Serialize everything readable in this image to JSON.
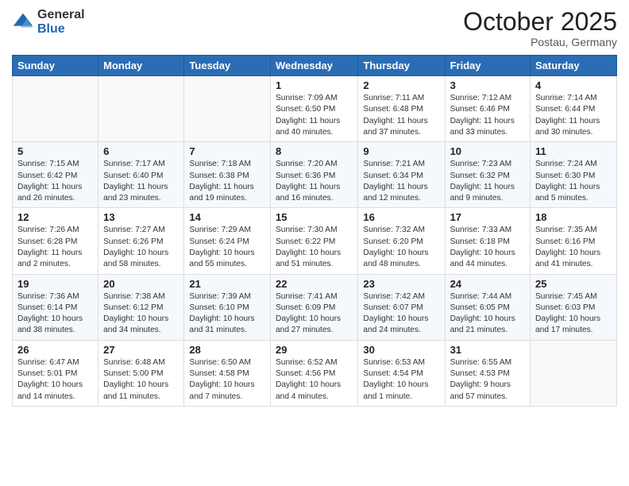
{
  "logo": {
    "general": "General",
    "blue": "Blue"
  },
  "header": {
    "month": "October 2025",
    "location": "Postau, Germany"
  },
  "days_of_week": [
    "Sunday",
    "Monday",
    "Tuesday",
    "Wednesday",
    "Thursday",
    "Friday",
    "Saturday"
  ],
  "weeks": [
    [
      {
        "day": "",
        "info": ""
      },
      {
        "day": "",
        "info": ""
      },
      {
        "day": "",
        "info": ""
      },
      {
        "day": "1",
        "info": "Sunrise: 7:09 AM\nSunset: 6:50 PM\nDaylight: 11 hours and 40 minutes."
      },
      {
        "day": "2",
        "info": "Sunrise: 7:11 AM\nSunset: 6:48 PM\nDaylight: 11 hours and 37 minutes."
      },
      {
        "day": "3",
        "info": "Sunrise: 7:12 AM\nSunset: 6:46 PM\nDaylight: 11 hours and 33 minutes."
      },
      {
        "day": "4",
        "info": "Sunrise: 7:14 AM\nSunset: 6:44 PM\nDaylight: 11 hours and 30 minutes."
      }
    ],
    [
      {
        "day": "5",
        "info": "Sunrise: 7:15 AM\nSunset: 6:42 PM\nDaylight: 11 hours and 26 minutes."
      },
      {
        "day": "6",
        "info": "Sunrise: 7:17 AM\nSunset: 6:40 PM\nDaylight: 11 hours and 23 minutes."
      },
      {
        "day": "7",
        "info": "Sunrise: 7:18 AM\nSunset: 6:38 PM\nDaylight: 11 hours and 19 minutes."
      },
      {
        "day": "8",
        "info": "Sunrise: 7:20 AM\nSunset: 6:36 PM\nDaylight: 11 hours and 16 minutes."
      },
      {
        "day": "9",
        "info": "Sunrise: 7:21 AM\nSunset: 6:34 PM\nDaylight: 11 hours and 12 minutes."
      },
      {
        "day": "10",
        "info": "Sunrise: 7:23 AM\nSunset: 6:32 PM\nDaylight: 11 hours and 9 minutes."
      },
      {
        "day": "11",
        "info": "Sunrise: 7:24 AM\nSunset: 6:30 PM\nDaylight: 11 hours and 5 minutes."
      }
    ],
    [
      {
        "day": "12",
        "info": "Sunrise: 7:26 AM\nSunset: 6:28 PM\nDaylight: 11 hours and 2 minutes."
      },
      {
        "day": "13",
        "info": "Sunrise: 7:27 AM\nSunset: 6:26 PM\nDaylight: 10 hours and 58 minutes."
      },
      {
        "day": "14",
        "info": "Sunrise: 7:29 AM\nSunset: 6:24 PM\nDaylight: 10 hours and 55 minutes."
      },
      {
        "day": "15",
        "info": "Sunrise: 7:30 AM\nSunset: 6:22 PM\nDaylight: 10 hours and 51 minutes."
      },
      {
        "day": "16",
        "info": "Sunrise: 7:32 AM\nSunset: 6:20 PM\nDaylight: 10 hours and 48 minutes."
      },
      {
        "day": "17",
        "info": "Sunrise: 7:33 AM\nSunset: 6:18 PM\nDaylight: 10 hours and 44 minutes."
      },
      {
        "day": "18",
        "info": "Sunrise: 7:35 AM\nSunset: 6:16 PM\nDaylight: 10 hours and 41 minutes."
      }
    ],
    [
      {
        "day": "19",
        "info": "Sunrise: 7:36 AM\nSunset: 6:14 PM\nDaylight: 10 hours and 38 minutes."
      },
      {
        "day": "20",
        "info": "Sunrise: 7:38 AM\nSunset: 6:12 PM\nDaylight: 10 hours and 34 minutes."
      },
      {
        "day": "21",
        "info": "Sunrise: 7:39 AM\nSunset: 6:10 PM\nDaylight: 10 hours and 31 minutes."
      },
      {
        "day": "22",
        "info": "Sunrise: 7:41 AM\nSunset: 6:09 PM\nDaylight: 10 hours and 27 minutes."
      },
      {
        "day": "23",
        "info": "Sunrise: 7:42 AM\nSunset: 6:07 PM\nDaylight: 10 hours and 24 minutes."
      },
      {
        "day": "24",
        "info": "Sunrise: 7:44 AM\nSunset: 6:05 PM\nDaylight: 10 hours and 21 minutes."
      },
      {
        "day": "25",
        "info": "Sunrise: 7:45 AM\nSunset: 6:03 PM\nDaylight: 10 hours and 17 minutes."
      }
    ],
    [
      {
        "day": "26",
        "info": "Sunrise: 6:47 AM\nSunset: 5:01 PM\nDaylight: 10 hours and 14 minutes."
      },
      {
        "day": "27",
        "info": "Sunrise: 6:48 AM\nSunset: 5:00 PM\nDaylight: 10 hours and 11 minutes."
      },
      {
        "day": "28",
        "info": "Sunrise: 6:50 AM\nSunset: 4:58 PM\nDaylight: 10 hours and 7 minutes."
      },
      {
        "day": "29",
        "info": "Sunrise: 6:52 AM\nSunset: 4:56 PM\nDaylight: 10 hours and 4 minutes."
      },
      {
        "day": "30",
        "info": "Sunrise: 6:53 AM\nSunset: 4:54 PM\nDaylight: 10 hours and 1 minute."
      },
      {
        "day": "31",
        "info": "Sunrise: 6:55 AM\nSunset: 4:53 PM\nDaylight: 9 hours and 57 minutes."
      },
      {
        "day": "",
        "info": ""
      }
    ]
  ]
}
